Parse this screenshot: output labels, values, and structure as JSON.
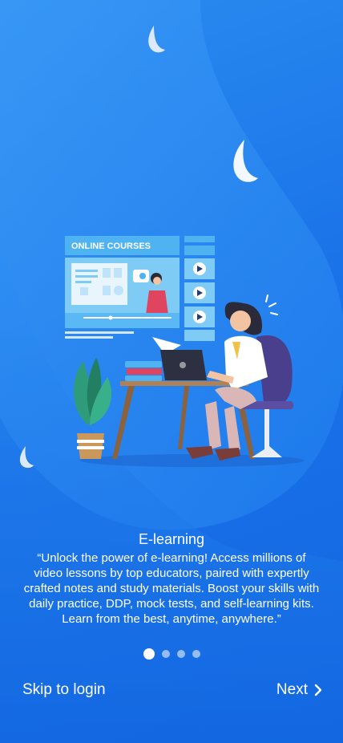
{
  "onboarding": {
    "illustration": {
      "banner_text": "ONLINE COURSES",
      "icon": "e-learning-illustration"
    },
    "title": "E-learning",
    "description": "“Unlock the power of e-learning! Access millions of video lessons by top educators, paired with expertly crafted notes and study materials. Boost your skills with daily practice, DDP, mock tests, and self-learning kits. Learn from the best, anytime, anywhere.”",
    "pagination": {
      "total": 4,
      "active": 1
    },
    "skip_label": "Skip to login",
    "next_label": "Next",
    "next_icon": "chevron-right-icon"
  },
  "colors": {
    "background": "#1a73e8",
    "accent": "#ffffff"
  }
}
